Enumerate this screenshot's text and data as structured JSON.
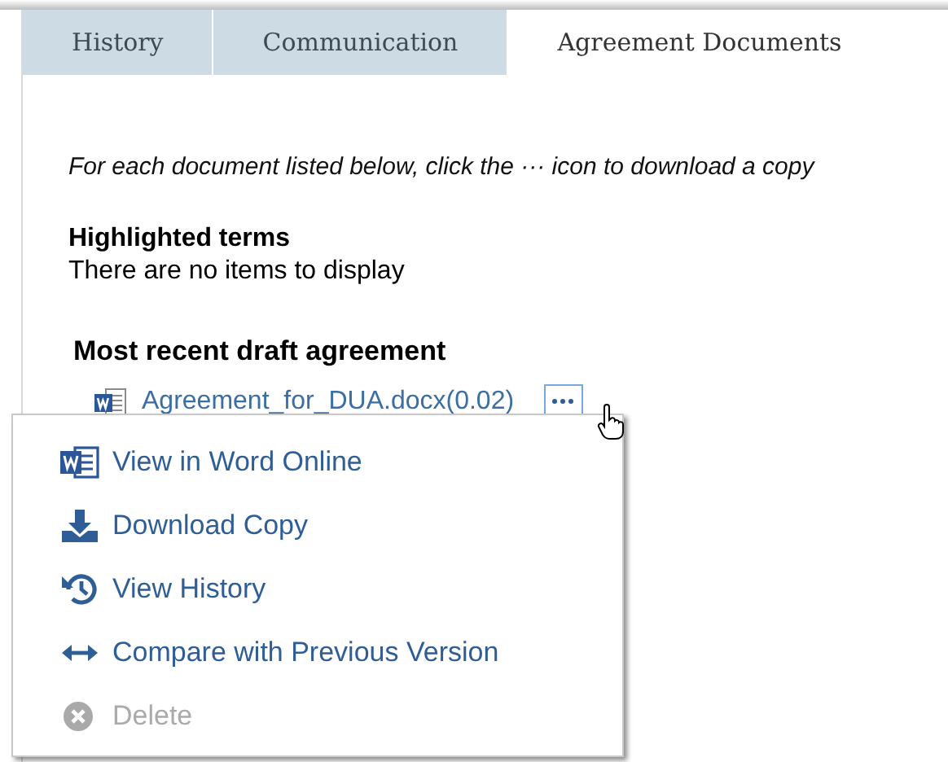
{
  "tabs": [
    {
      "label": "History",
      "selected": false
    },
    {
      "label": "Communication",
      "selected": false
    },
    {
      "label": "Agreement Documents",
      "selected": true
    }
  ],
  "instruction": "For each document listed below, click the ··· icon to download a copy",
  "highlighted_terms": {
    "title": "Highlighted terms",
    "empty_message": "There are no items to display"
  },
  "draft": {
    "title": "Most recent draft agreement",
    "file": "Agreement_for_DUA.docx(0.02)"
  },
  "menu": [
    {
      "kind": "word",
      "label": "View in Word Online",
      "disabled": false
    },
    {
      "kind": "download",
      "label": "Download Copy",
      "disabled": false
    },
    {
      "kind": "history",
      "label": "View History",
      "disabled": false
    },
    {
      "kind": "compare",
      "label": "Compare with Previous Version",
      "disabled": false
    },
    {
      "kind": "delete",
      "label": "Delete",
      "disabled": true
    }
  ]
}
